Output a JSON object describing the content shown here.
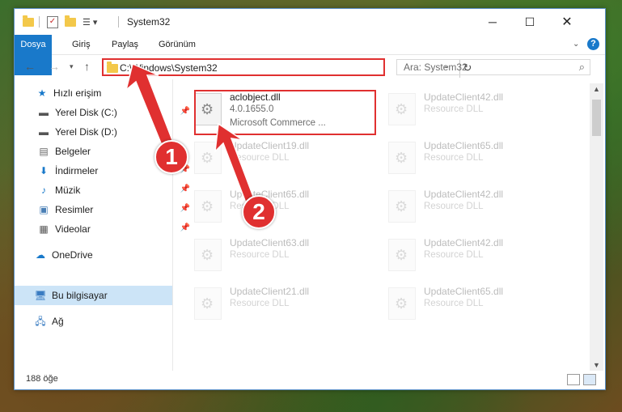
{
  "window": {
    "title": "System32"
  },
  "ribbon": {
    "tabs": [
      "Dosya",
      "Giriş",
      "Paylaş",
      "Görünüm"
    ],
    "help": "?"
  },
  "nav": {
    "address": "C:\\Windows\\System32",
    "search_placeholder": "Ara: System32"
  },
  "sidebar": {
    "items": [
      {
        "label": "Hızlı erişim",
        "icon": "star-icon"
      },
      {
        "label": "Yerel Disk (C:)",
        "icon": "drive-icon"
      },
      {
        "label": "Yerel Disk (D:)",
        "icon": "drive-icon"
      },
      {
        "label": "Belgeler",
        "icon": "documents-icon"
      },
      {
        "label": "İndirmeler",
        "icon": "download-icon"
      },
      {
        "label": "Müzik",
        "icon": "music-icon"
      },
      {
        "label": "Resimler",
        "icon": "pictures-icon"
      },
      {
        "label": "Videolar",
        "icon": "videos-icon"
      },
      {
        "label": "OneDrive",
        "icon": "cloud-icon"
      },
      {
        "label": "Bu bilgisayar",
        "icon": "computer-icon"
      },
      {
        "label": "Ağ",
        "icon": "network-icon"
      }
    ]
  },
  "files": [
    {
      "name": "aclobject.dll",
      "line1": "4.0.1655.0",
      "line2": "Microsoft Commerce ..."
    },
    {
      "name": "UpdateClient42.dll",
      "line1": "Resource DLL"
    },
    {
      "name": "UpdateClient19.dll",
      "line1": "Resource DLL"
    },
    {
      "name": "UpdateClient65.dll",
      "line1": "Resource DLL"
    },
    {
      "name": "UpdateClient65.dll",
      "line1": "Resource DLL"
    },
    {
      "name": "UpdateClient42.dll",
      "line1": "Resource DLL"
    },
    {
      "name": "UpdateClient63.dll",
      "line1": "Resource DLL"
    },
    {
      "name": "UpdateClient42.dll",
      "line1": "Resource DLL"
    },
    {
      "name": "UpdateClient21.dll",
      "line1": "Resource DLL"
    },
    {
      "name": "UpdateClient65.dll",
      "line1": "Resource DLL"
    }
  ],
  "status": {
    "count": "188 öğe"
  },
  "annotations": {
    "step1": "1",
    "step2": "2"
  },
  "colors": {
    "accent": "#1979ca",
    "highlight": "#e03030",
    "selected": "#cce4f7"
  }
}
